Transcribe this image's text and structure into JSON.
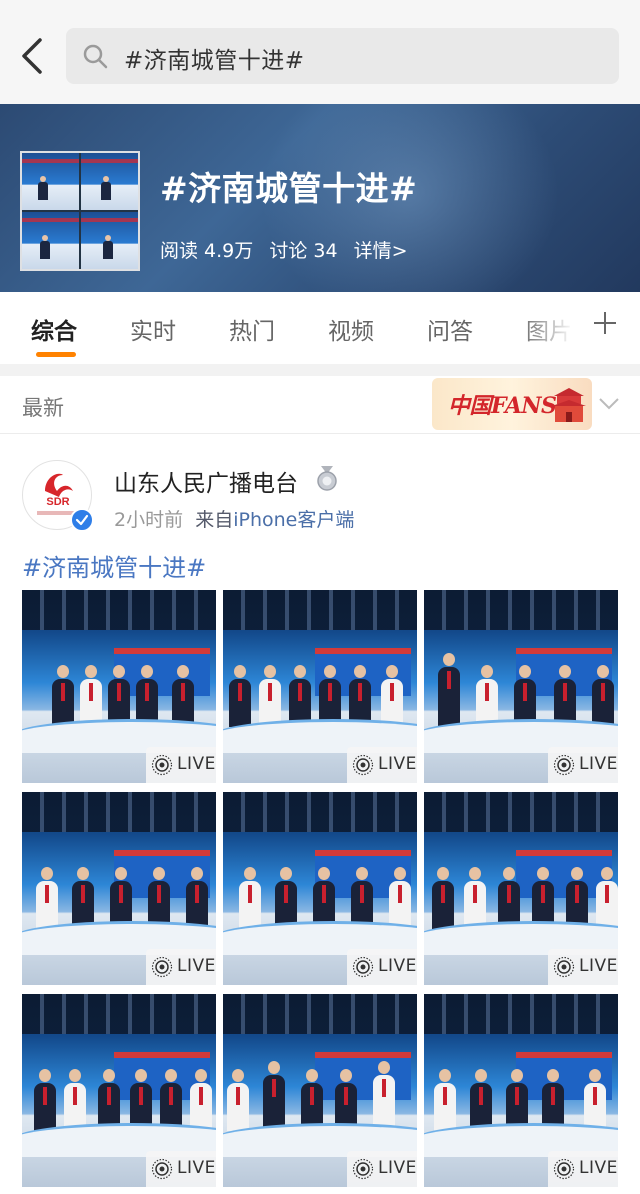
{
  "search": {
    "query": "#济南城管十进#"
  },
  "topic": {
    "title": "#济南城管十进#",
    "reads": "阅读 4.9万",
    "discussions": "讨论 34",
    "details": "详情>"
  },
  "tabs": [
    "综合",
    "实时",
    "热门",
    "视频",
    "问答",
    "图片"
  ],
  "active_tab": "综合",
  "sort": {
    "label": "最新",
    "promo_text": "中国FANS"
  },
  "post": {
    "author": "山东人民广播电台",
    "avatar_logo_text": "SDR",
    "time": "2小时前",
    "source_prefix": "来自",
    "source": "iPhone客户端",
    "text": "#济南城管十进#",
    "photos": [
      "LIVE",
      "LIVE",
      "LIVE",
      "LIVE",
      "LIVE",
      "LIVE",
      "LIVE",
      "LIVE",
      "LIVE"
    ]
  },
  "colors": {
    "accent": "#ff8200",
    "link": "#4a77c2",
    "verified": "#2f7ee8"
  }
}
